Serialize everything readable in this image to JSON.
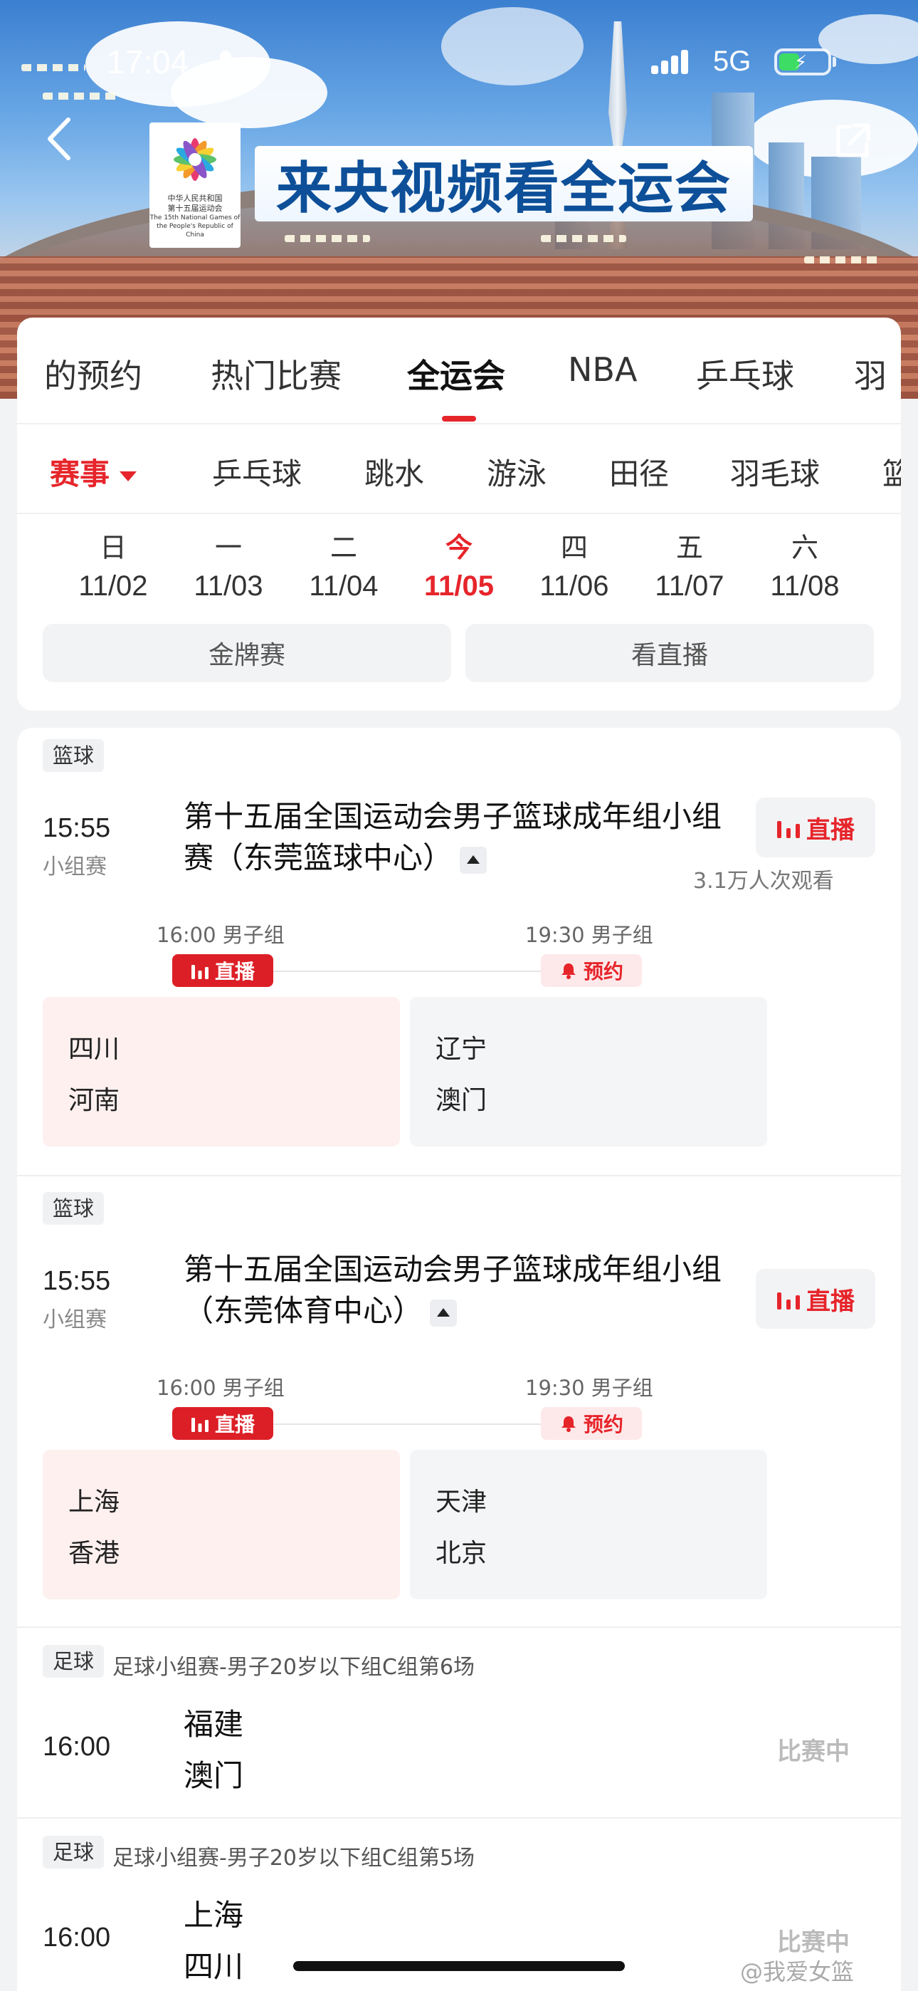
{
  "status_bar": {
    "time": "17:04",
    "network": "5G",
    "battery_icon": "battery-charging-icon"
  },
  "header": {
    "title": "来央视频看全运会",
    "logo": {
      "line1": "中华人民共和国",
      "line2": "第十五届运动会",
      "line3": "The 15th National Games of",
      "line4": "the People's Republic of China"
    }
  },
  "main_tabs": [
    "的预约",
    "热门比赛",
    "全运会",
    "NBA",
    "乒乓球",
    "羽"
  ],
  "main_tab_active": "全运会",
  "sub_tabs": [
    "赛事",
    "乒乓球",
    "跳水",
    "游泳",
    "田径",
    "羽毛球",
    "篮"
  ],
  "days": [
    {
      "weekday": "日",
      "date": "11/02"
    },
    {
      "weekday": "一",
      "date": "11/03"
    },
    {
      "weekday": "二",
      "date": "11/04"
    },
    {
      "weekday": "今",
      "date": "11/05",
      "today": true
    },
    {
      "weekday": "四",
      "date": "11/06"
    },
    {
      "weekday": "五",
      "date": "11/07"
    },
    {
      "weekday": "六",
      "date": "11/08"
    }
  ],
  "filters": {
    "gold": "金牌赛",
    "live": "看直播"
  },
  "matches": [
    {
      "sport": "篮球",
      "time": "15:55",
      "stage": "小组赛",
      "title": "第十五届全国运动会男子篮球成年组小组赛（东莞篮球中心）",
      "live_label": "直播",
      "viewers": "3.1万人次观看",
      "slots": [
        {
          "time": "16:00 男子组",
          "tag": "直播",
          "teams": [
            "四川",
            "河南"
          ]
        },
        {
          "time": "19:30 男子组",
          "tag": "预约",
          "teams": [
            "辽宁",
            "澳门"
          ]
        }
      ]
    },
    {
      "sport": "篮球",
      "time": "15:55",
      "stage": "小组赛",
      "title": "第十五届全国运动会男子篮球成年组小组（东莞体育中心）",
      "live_label": "直播",
      "slots": [
        {
          "time": "16:00 男子组",
          "tag": "直播",
          "teams": [
            "上海",
            "香港"
          ]
        },
        {
          "time": "19:30 男子组",
          "tag": "预约",
          "teams": [
            "天津",
            "北京"
          ]
        }
      ]
    },
    {
      "sport": "足球",
      "desc": "足球小组赛-男子20岁以下组C组第6场",
      "time": "16:00",
      "teams": [
        "福建",
        "澳门"
      ],
      "status": "比赛中"
    },
    {
      "sport": "足球",
      "desc": "足球小组赛-男子20岁以下组C组第5场",
      "time": "16:00",
      "teams": [
        "上海",
        "四川"
      ],
      "status": "比赛中"
    }
  ],
  "watermark": "@我爱女篮",
  "colors": {
    "accent": "#e6252b",
    "live_tag": "#dc1f26",
    "title_blue": "#0d4f98"
  }
}
